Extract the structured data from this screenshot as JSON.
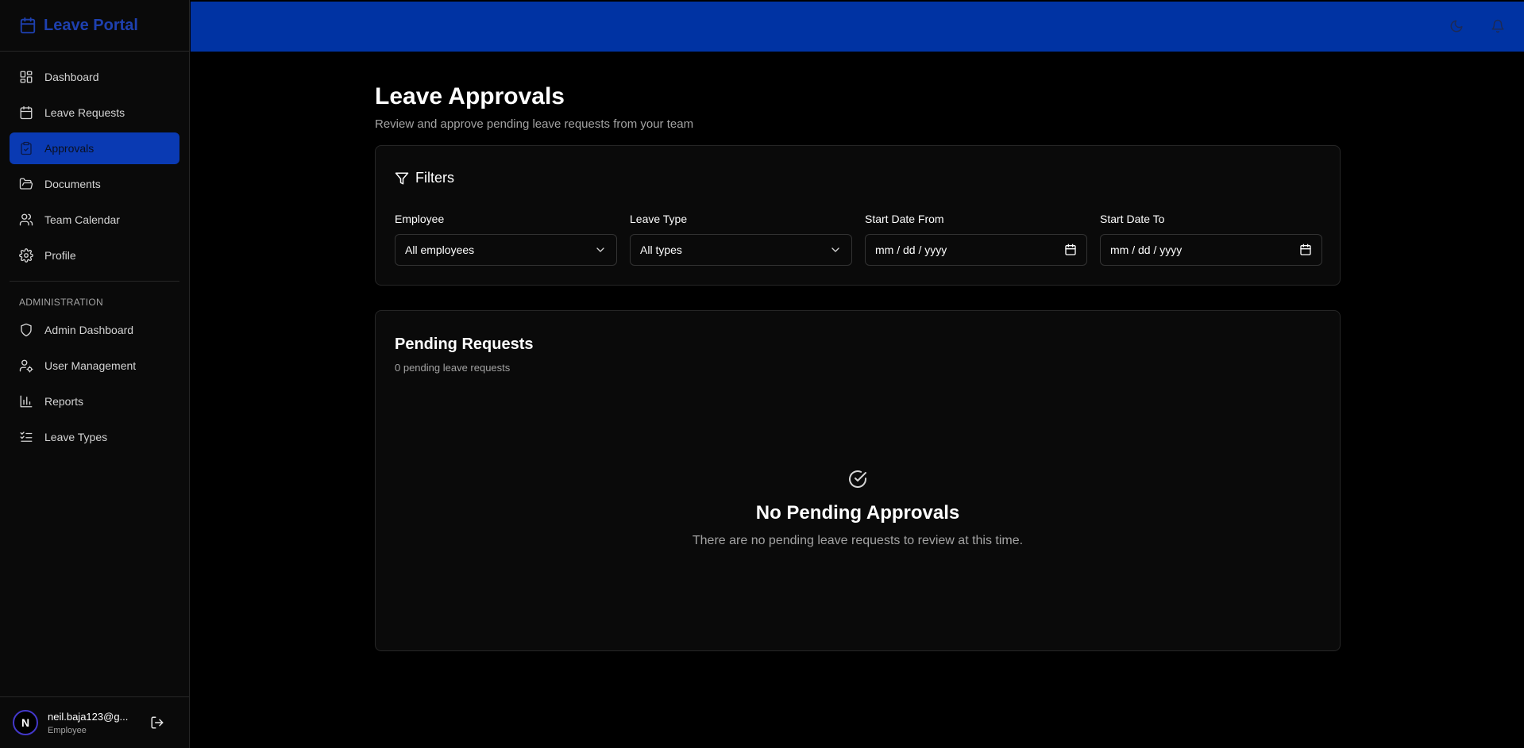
{
  "brand": {
    "title": "Leave Portal"
  },
  "nav": {
    "items": [
      {
        "label": "Dashboard",
        "icon": "layout-dashboard-icon"
      },
      {
        "label": "Leave Requests",
        "icon": "calendar-icon"
      },
      {
        "label": "Approvals",
        "icon": "clipboard-check-icon",
        "active": true
      },
      {
        "label": "Documents",
        "icon": "folder-open-icon"
      },
      {
        "label": "Team Calendar",
        "icon": "users-icon"
      },
      {
        "label": "Profile",
        "icon": "gear-icon"
      }
    ],
    "admin_title": "ADMINISTRATION",
    "admin_items": [
      {
        "label": "Admin Dashboard",
        "icon": "shield-icon"
      },
      {
        "label": "User Management",
        "icon": "user-cog-icon"
      },
      {
        "label": "Reports",
        "icon": "bar-chart-icon"
      },
      {
        "label": "Leave Types",
        "icon": "list-checks-icon"
      }
    ]
  },
  "user": {
    "initial": "N",
    "email": "neil.baja123@g...",
    "role": "Employee"
  },
  "page": {
    "title": "Leave Approvals",
    "subtitle": "Review and approve pending leave requests from your team"
  },
  "filters": {
    "title": "Filters",
    "employee": {
      "label": "Employee",
      "value": "All employees"
    },
    "leave_type": {
      "label": "Leave Type",
      "value": "All types"
    },
    "start_from": {
      "label": "Start Date From",
      "placeholder": "mm / dd / yyyy"
    },
    "start_to": {
      "label": "Start Date To",
      "placeholder": "mm / dd / yyyy"
    }
  },
  "pending": {
    "title": "Pending Requests",
    "count_text": "0 pending leave requests",
    "empty_title": "No Pending Approvals",
    "empty_text": "There are no pending leave requests to review at this time."
  },
  "colors": {
    "accent": "#0033a3",
    "active_nav": "#0a3ab3",
    "brand_text": "#1e40af"
  }
}
